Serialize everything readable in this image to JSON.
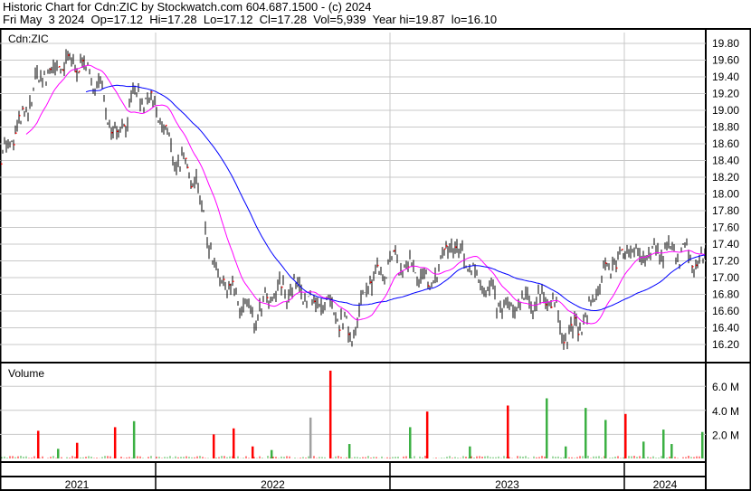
{
  "header": {
    "line1": "Historic Chart for Cdn:ZIC by Stockwatch.com 604.687.1500 - (c) 2024",
    "line2": "Fri May  3 2024  Op=17.12  Hi=17.28  Lo=17.12  Cl=17.28  Vol=5,939  Year hi=19.87  lo=16.10"
  },
  "chart_data": {
    "type": "line",
    "title": "Historic Chart for Cdn:ZIC",
    "symbol_label": "Cdn:ZIC",
    "volume_label": "Volume",
    "price_ylim": [
      16.1,
      19.9
    ],
    "price_ticks": [
      "19.80",
      "19.60",
      "19.40",
      "19.20",
      "19.00",
      "18.80",
      "18.60",
      "18.40",
      "18.20",
      "18.00",
      "17.80",
      "17.60",
      "17.40",
      "17.20",
      "17.00",
      "16.80",
      "16.60",
      "16.40",
      "16.20"
    ],
    "volume_ticks": [
      "6.0 M",
      "4.0 M",
      "2.0 M"
    ],
    "year_labels": [
      "2021",
      "2022",
      "2023",
      "2024"
    ],
    "x_range_years": [
      2021.336,
      2024.345
    ],
    "monthly_close": [
      [
        "2021-04",
        18.4
      ],
      [
        "2021-05",
        18.8
      ],
      [
        "2021-06",
        19.4
      ],
      [
        "2021-07",
        19.5
      ],
      [
        "2021-08",
        19.6
      ],
      [
        "2021-09",
        19.3
      ],
      [
        "2021-10",
        18.7
      ],
      [
        "2021-11",
        19.2
      ],
      [
        "2021-12",
        19.0
      ],
      [
        "2022-01",
        18.4
      ],
      [
        "2022-02",
        18.2
      ],
      [
        "2022-03",
        17.1
      ],
      [
        "2022-04",
        16.8
      ],
      [
        "2022-05",
        16.5
      ],
      [
        "2022-06",
        16.8
      ],
      [
        "2022-07",
        16.9
      ],
      [
        "2022-08",
        16.7
      ],
      [
        "2022-09",
        16.6
      ],
      [
        "2022-10",
        16.3
      ],
      [
        "2022-11",
        17.0
      ],
      [
        "2022-12",
        17.2
      ],
      [
        "2023-01",
        17.1
      ],
      [
        "2023-02",
        16.9
      ],
      [
        "2023-03",
        17.4
      ],
      [
        "2023-04",
        17.2
      ],
      [
        "2023-05",
        16.8
      ],
      [
        "2023-06",
        16.6
      ],
      [
        "2023-07",
        16.7
      ],
      [
        "2023-08",
        16.8
      ],
      [
        "2023-09",
        16.3
      ],
      [
        "2023-10",
        16.5
      ],
      [
        "2023-11",
        17.1
      ],
      [
        "2023-12",
        17.3
      ],
      [
        "2024-01",
        17.3
      ],
      [
        "2024-02",
        17.3
      ],
      [
        "2024-03",
        17.3
      ],
      [
        "2024-04",
        17.2
      ]
    ],
    "volume_spikes_millions": [
      [
        2021.498,
        2.3,
        "down"
      ],
      [
        2021.583,
        0.8,
        "up"
      ],
      [
        2021.664,
        1.3,
        "down"
      ],
      [
        2021.826,
        2.6,
        "down"
      ],
      [
        2021.907,
        3.1,
        "up"
      ],
      [
        2022.247,
        2.0,
        "down"
      ],
      [
        2022.332,
        2.5,
        "down"
      ],
      [
        2022.413,
        1.0,
        "down"
      ],
      [
        2022.494,
        0.7,
        "up"
      ],
      [
        2022.66,
        3.4,
        "flat"
      ],
      [
        2022.745,
        7.3,
        "down"
      ],
      [
        2022.826,
        1.2,
        "up"
      ],
      [
        2023.085,
        2.6,
        "up"
      ],
      [
        2023.158,
        3.9,
        "down"
      ],
      [
        2023.34,
        1.0,
        "up"
      ],
      [
        2023.502,
        4.4,
        "down"
      ],
      [
        2023.668,
        5.0,
        "up"
      ],
      [
        2023.749,
        1.0,
        "up"
      ],
      [
        2023.834,
        4.2,
        "up"
      ],
      [
        2023.919,
        3.2,
        "up"
      ],
      [
        2024.004,
        3.7,
        "down"
      ],
      [
        2024.081,
        1.4,
        "up"
      ],
      [
        2024.166,
        2.4,
        "up"
      ],
      [
        2024.201,
        1.2,
        "up"
      ],
      [
        2024.332,
        2.2,
        "up"
      ]
    ],
    "moving_averages": [
      "20-day",
      "50-day"
    ],
    "colors": {
      "up": "#3cb043",
      "down": "#ff0000",
      "flat": "#a0a0a0",
      "bars": "#000000",
      "ma_short": "#ff00ff",
      "ma_long": "#0000ff",
      "grid": "#c8c8c8"
    }
  }
}
